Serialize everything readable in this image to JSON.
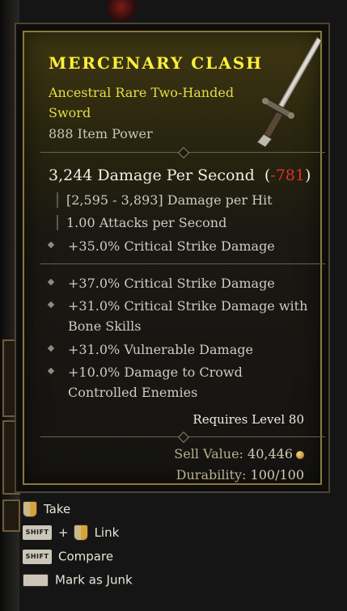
{
  "item": {
    "name": "Mercenary Clash",
    "type": "Ancestral Rare Two-Handed Sword",
    "power": "888 Item Power",
    "dps_value": "3,244 Damage Per Second",
    "dps_open": "(",
    "dps_diff": "-781",
    "dps_close": ")",
    "damage_per_hit": "[2,595 - 3,893] Damage per Hit",
    "attacks_per_second": "1.00 Attacks per Second",
    "implicit": "+35.0% Critical Strike Damage",
    "affixes": [
      "+37.0% Critical Strike Damage",
      "+31.0% Critical Strike Damage with Bone Skills",
      "+31.0% Vulnerable Damage",
      "+10.0% Damage to Crowd Controlled Enemies"
    ],
    "requires": "Requires Level 80",
    "sell_label": "Sell Value:",
    "sell_value": "40,446",
    "durability_label": "Durability:",
    "durability_value": "100/100"
  },
  "actions": {
    "take": "Take",
    "link": "Link",
    "compare": "Compare",
    "junk": "Mark as Junk",
    "shift_key": "SHIFT",
    "plus": "+"
  },
  "colors": {
    "rare_name": "#ffef3a",
    "rare_type": "#e7dd45",
    "negative": "#e0302a"
  },
  "icons": [
    "sword-image",
    "gold-icon",
    "mouse-left-icon",
    "mouse-right-icon",
    "shift-key-icon",
    "spacebar-icon"
  ]
}
